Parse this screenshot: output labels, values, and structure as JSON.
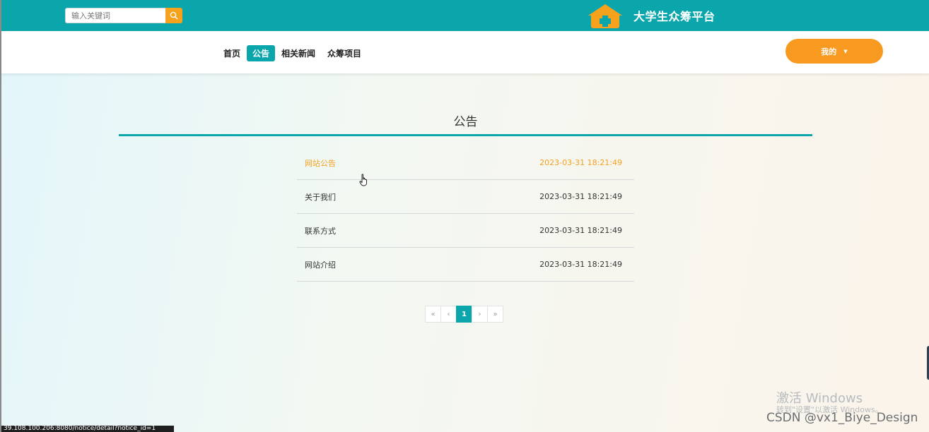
{
  "header": {
    "search": {
      "placeholder": "输入关键词",
      "value": ""
    },
    "brand": {
      "title": "大学生众筹平台",
      "logo_icon": "house-plus-icon",
      "logo_color": "#f7a21c"
    },
    "background_color": "#0aa6ab"
  },
  "nav": {
    "items": [
      {
        "label": "首页",
        "active": false
      },
      {
        "label": "公告",
        "active": true
      },
      {
        "label": "相关新闻",
        "active": false
      },
      {
        "label": "众筹项目",
        "active": false
      }
    ],
    "my_button": {
      "label": "我的",
      "icon": "caret-down-icon",
      "color": "#f99a20"
    }
  },
  "main": {
    "title": "公告",
    "notices": [
      {
        "title": "网站公告",
        "date": "2023-03-31 18:21:49"
      },
      {
        "title": "关于我们",
        "date": "2023-03-31 18:21:49"
      },
      {
        "title": "联系方式",
        "date": "2023-03-31 18:21:49"
      },
      {
        "title": "网站介绍",
        "date": "2023-03-31 18:21:49"
      }
    ],
    "hover_color": "#f5a020",
    "pagination": {
      "first": "«",
      "prev": "‹",
      "current": "1",
      "next": "›",
      "last": "»"
    }
  },
  "overlays": {
    "activation_title": "激活 Windows",
    "activation_sub": "转到\"设置\"以激活 Windows。",
    "csdn_watermark": "CSDN @vx1_Biye_Design",
    "status_url": "39.108.100.206:8080/notice/detail?notice_id=1"
  },
  "accent_color": "#0aa6ab"
}
